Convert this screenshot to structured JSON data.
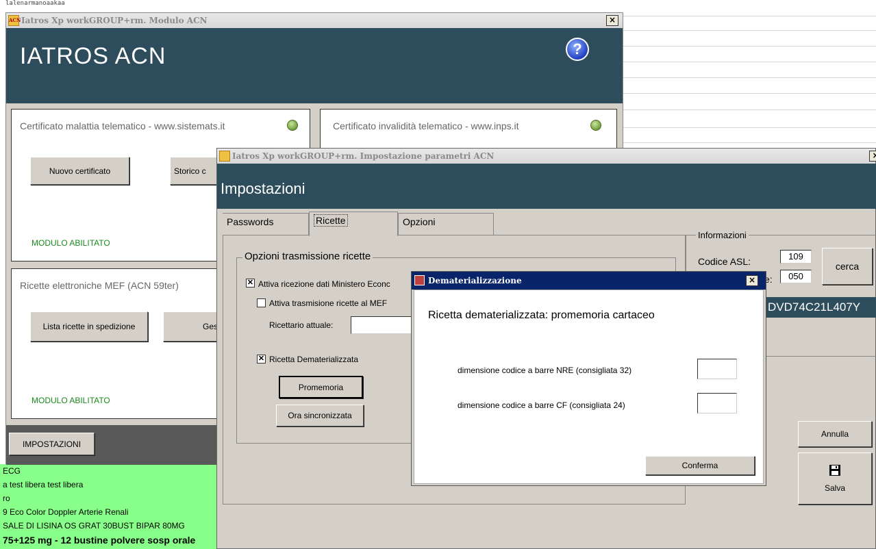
{
  "background": {
    "top_text": "lalenarmanoaakaa",
    "green_list": [
      "ECG",
      "a test libera test libera",
      "ro",
      "9 Eco Color Doppler Arterie Renali",
      "SALE DI LISINA OS GRAT 30BUST BIPAR 80MG",
      "75+125 mg - 12 bustine polvere sosp orale"
    ]
  },
  "win1": {
    "title": "Iatros Xp workGROUP+rm. Modulo ACN",
    "app_icon": "ACN",
    "close": "×",
    "heading": "IATROS ACN",
    "help": "?",
    "panel_malattia": {
      "title": "Certificato malattia telematico - www.sistemats.it",
      "btn_nuovo": "Nuovo certificato",
      "btn_storico": "Storico c",
      "status": "MODULO ABILITATO"
    },
    "panel_invalidita": {
      "title": "Certificato invalidità telematico - www.inps.it"
    },
    "panel_ricette": {
      "title": "Ricette elettroniche MEF (ACN 59ter)",
      "btn_lista": "Lista ricette in spedizione",
      "btn_ges": "Ges",
      "status": "MODULO ABILITATO"
    },
    "btn_impostazioni": "IMPOSTAZIONI"
  },
  "win2": {
    "title": "Iatros Xp workGROUP+rm. Impostazione parametri ACN",
    "close": "×",
    "heading": "Impostazioni",
    "tabs": [
      "Passwords",
      "Ricette",
      "Opzioni"
    ],
    "group_title": "Opzioni trasmissione ricette",
    "chk_attiva_ricezione": "Attiva ricezione dati Ministero Econc",
    "chk_attiva_trasmissione": "Attiva trasmisione ricette al MEF",
    "lbl_ricettario": "Ricettario attuale:",
    "chk_dematerializzata": "Ricetta Dematerializzata",
    "btn_promemoria": "Promemoria",
    "btn_ora": "Ora sincronizzata",
    "info": {
      "title": "Informazioni",
      "lbl_codice_asl": "Codice ASL:",
      "codice_asl": "109",
      "lbl_second": "e:",
      "second_value": "050",
      "btn_cerca": "cerca",
      "cf_partial": "DVD74C21L407Y"
    },
    "btn_annulla": "Annulla",
    "btn_salva": "Salva",
    "save_icon": "floppy-disk"
  },
  "win3": {
    "title": "Dematerializzazione",
    "close": "×",
    "heading": "Ricetta dematerializzata: promemoria cartaceo",
    "lbl_nre": "dimensione codice a barre NRE (consigliata 32)",
    "val_nre": "",
    "lbl_cf": "dimensione codice a barre CF (consigliata 24)",
    "val_cf": "",
    "btn_conferma": "Conferma"
  }
}
